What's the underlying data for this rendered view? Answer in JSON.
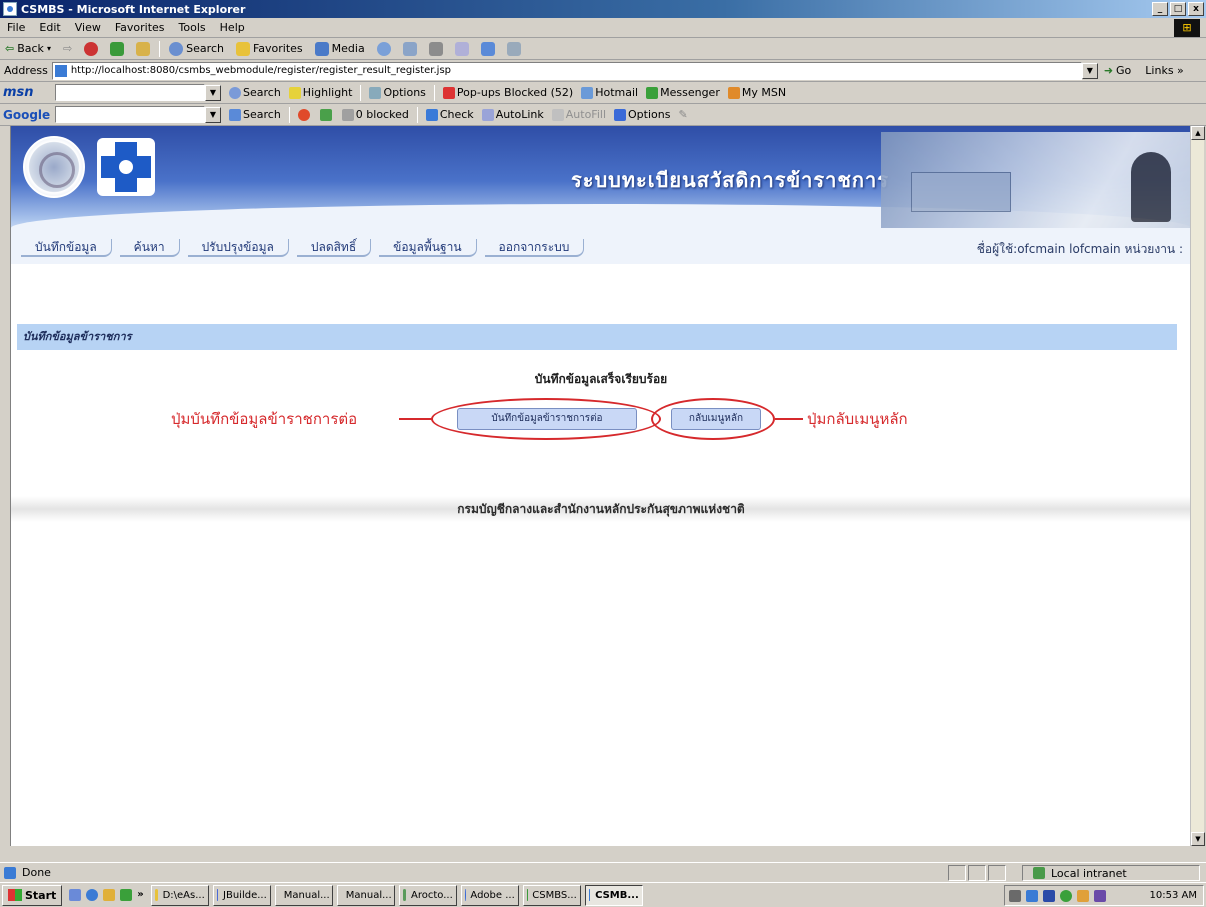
{
  "window": {
    "title": "CSMBS - Microsoft Internet Explorer",
    "min_label": "_",
    "max_label": "□",
    "close_label": "x"
  },
  "menubar": {
    "items": [
      "File",
      "Edit",
      "View",
      "Favorites",
      "Tools",
      "Help"
    ]
  },
  "toolbar": {
    "back": "Back",
    "search": "Search",
    "favorites": "Favorites",
    "media": "Media"
  },
  "address": {
    "label": "Address",
    "url": "http://localhost:8080/csmbs_webmodule/register/register_result_register.jsp",
    "go": "Go",
    "links": "Links »"
  },
  "msnbar": {
    "brand": "msn",
    "search": "Search",
    "highlight": "Highlight",
    "options": "Options",
    "popups": "Pop-ups Blocked (52)",
    "hotmail": "Hotmail",
    "messenger": "Messenger",
    "mymsn": "My MSN"
  },
  "googlebar": {
    "brand": "Google",
    "search": "Search",
    "blocked": "0 blocked",
    "check": "Check",
    "autolink": "AutoLink",
    "autofill": "AutoFill",
    "options": "Options"
  },
  "banner": {
    "title": "ระบบทะเบียนสวัสดิการข้าราชการ"
  },
  "nav": {
    "tabs": [
      "บันทึกข้อมูล",
      "ค้นหา",
      "ปรับปรุงข้อมูล",
      "ปลดสิทธิ์",
      "ข้อมูลพื้นฐาน",
      "ออกจากระบบ"
    ],
    "user_info": "ชื่อผู้ใช้:ofcmain lofcmain หน่วยงาน :"
  },
  "main": {
    "section_title": "บันทึกข้อมูลข้าราชการ",
    "success_message": "บันทึกข้อมูลเสร็จเรียบร้อย",
    "continue_button": "บันทึกข้อมูลข้าราชการต่อ",
    "back_button": "กลับเมนูหลัก",
    "annotation_left": "ปุ่มบันทึกข้อมูลข้าราชการต่อ",
    "annotation_right": "ปุ่มกลับเมนูหลัก",
    "footer": "กรมบัญชีกลางและสำนักงานหลักประกันสุขภาพแห่งชาติ"
  },
  "status": {
    "text": "Done",
    "zone": "Local intranet"
  },
  "taskbar": {
    "start": "Start",
    "tasks": [
      "D:\\eAs...",
      "JBuilde...",
      "Manual...",
      "Manual...",
      "Arocto...",
      "Adobe ...",
      "CSMBS...",
      "CSMB..."
    ],
    "clock": "10:53 AM"
  },
  "colors": {
    "annotation_red": "#d6292c",
    "section_blue": "#b7d3f4",
    "button_blue": "#c9d8f6"
  }
}
